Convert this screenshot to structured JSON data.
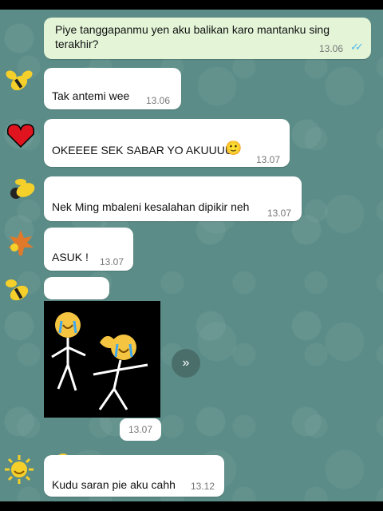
{
  "messages": [
    {
      "text": "Piye tanggapanmu yen aku balikan karo mantanku sing",
      "text2": "terakhir?",
      "time": "13.06",
      "ticks": "✓✓"
    },
    {
      "text": "Tak antemi wee",
      "time": "13.06"
    },
    {
      "text": "OKEEEE SEK SABAR YO AKUUUU",
      "emoji": "🙂",
      "time": "13.07"
    },
    {
      "text": "Nek Ming mbaleni kesalahan dipikir neh",
      "time": "13.07"
    },
    {
      "text": "ASUK !",
      "time": "13.07"
    },
    {
      "text": "13.07"
    },
    {
      "text": "Kudu saran pie aku cahh",
      "time": "13.12"
    }
  ],
  "colors": {
    "chat_bg": "#5b8c87",
    "out_bubble": "#e3f4d7",
    "in_bubble": "#ffffff",
    "tick_blue": "#4fb6ec",
    "name_yellow": "#f6d02a",
    "name_red": "#e0141e",
    "name_brown": "#9a5a3a"
  },
  "icons": {
    "forward": "forward-icon",
    "avatar1": "bee-icon",
    "avatar2": "heart-icon",
    "avatar3": "bee-icon",
    "avatar4": "maple-leaf-icon",
    "avatar5": "bee-icon",
    "avatar6": "sun-icon",
    "sticker": "crying-stickman-sticker"
  }
}
